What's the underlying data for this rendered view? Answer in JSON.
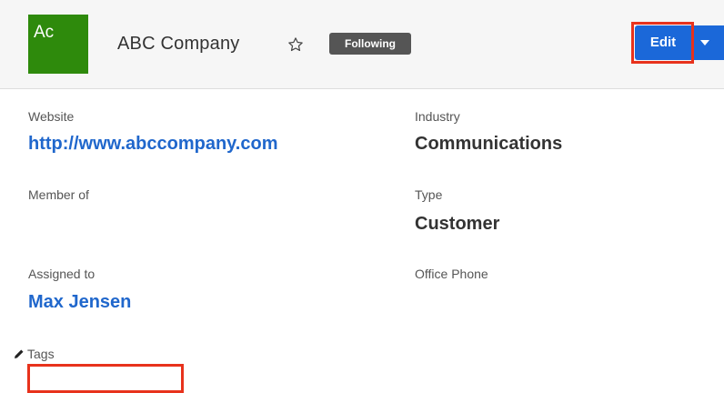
{
  "header": {
    "avatar_text": "Ac",
    "record_name": "ABC Company",
    "favorite_icon": "star-outline-icon",
    "following_label": "Following",
    "edit_label": "Edit",
    "dropdown_icon": "caret-down-icon",
    "colors": {
      "avatar_bg": "#2e8a0c",
      "edit_bg": "#1b68d9",
      "highlight": "#e8321c",
      "following_bg": "#555555"
    }
  },
  "fields": {
    "website": {
      "label": "Website",
      "value": "http://www.abccompany.com"
    },
    "industry": {
      "label": "Industry",
      "value": "Communications"
    },
    "member_of": {
      "label": "Member of",
      "value": ""
    },
    "type": {
      "label": "Type",
      "value": "Customer"
    },
    "assigned_to": {
      "label": "Assigned to",
      "value": "Max Jensen"
    },
    "office_phone": {
      "label": "Office Phone",
      "value": ""
    },
    "tags": {
      "label": "Tags",
      "value": "",
      "icon": "pencil-icon"
    }
  }
}
